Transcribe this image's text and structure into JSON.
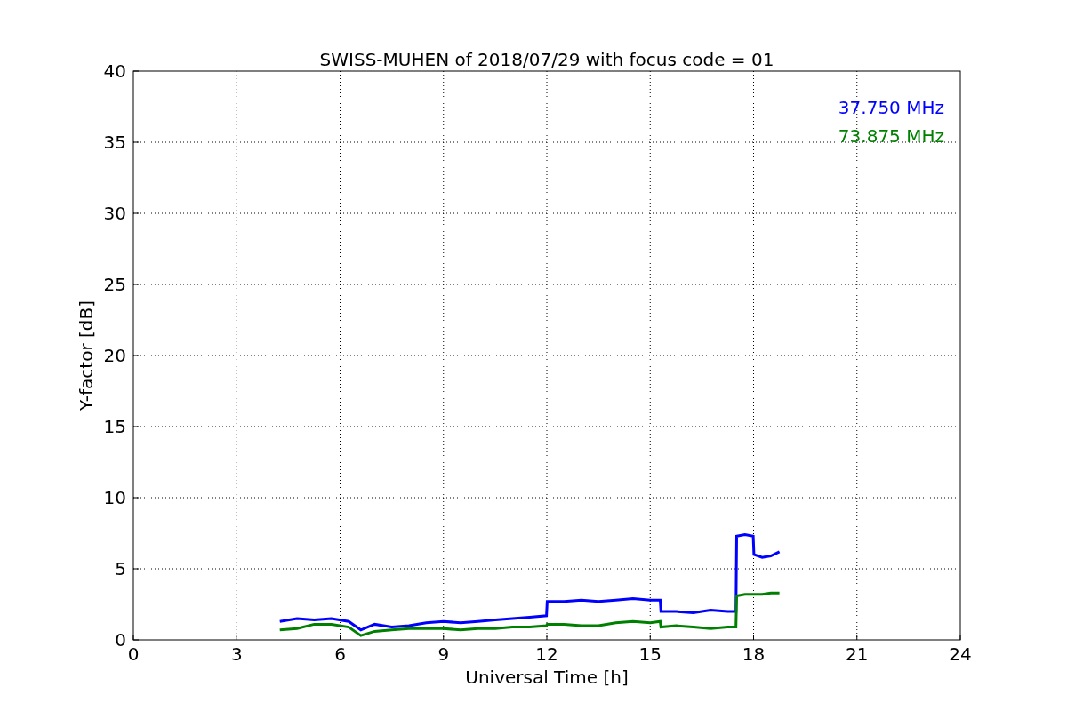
{
  "chart_data": {
    "type": "line",
    "title": "SWISS-MUHEN of 2018/07/29 with focus code = 01",
    "xlabel": "Universal Time [h]",
    "ylabel": "Y-factor [dB]",
    "x": [
      4.25,
      4.75,
      5.25,
      5.75,
      6.25,
      6.6,
      7,
      7.5,
      8,
      8.5,
      9,
      9.5,
      10,
      10.5,
      11,
      11.5,
      11.99,
      12.01,
      12.5,
      13,
      13.5,
      14,
      14.5,
      15,
      15.29,
      15.31,
      15.75,
      16.25,
      16.75,
      17.25,
      17.49,
      17.51,
      17.75,
      17.99,
      18.01,
      18.25,
      18.5,
      18.75
    ],
    "series": [
      {
        "name": "37.750 MHz",
        "color": "#0000ff",
        "values": [
          1.3,
          1.5,
          1.4,
          1.5,
          1.3,
          0.7,
          1.1,
          0.9,
          1.0,
          1.2,
          1.3,
          1.2,
          1.3,
          1.4,
          1.5,
          1.6,
          1.7,
          2.7,
          2.7,
          2.8,
          2.7,
          2.8,
          2.9,
          2.8,
          2.8,
          2.0,
          2.0,
          1.9,
          2.1,
          2.0,
          2.0,
          7.3,
          7.4,
          7.3,
          6.0,
          5.8,
          5.9,
          6.2
        ]
      },
      {
        "name": "73.875 MHz",
        "color": "#008000",
        "values": [
          0.7,
          0.8,
          1.1,
          1.1,
          0.9,
          0.3,
          0.6,
          0.7,
          0.8,
          0.8,
          0.8,
          0.7,
          0.8,
          0.8,
          0.9,
          0.9,
          1.0,
          1.1,
          1.1,
          1.0,
          1.0,
          1.2,
          1.3,
          1.2,
          1.3,
          0.9,
          1.0,
          0.9,
          0.8,
          0.9,
          0.9,
          3.1,
          3.2,
          3.2,
          3.2,
          3.2,
          3.3,
          3.3
        ]
      }
    ],
    "xlim": [
      0,
      24
    ],
    "ylim": [
      0,
      40
    ],
    "xticks": [
      0,
      3,
      6,
      9,
      12,
      15,
      18,
      21,
      24
    ],
    "yticks": [
      0,
      5,
      10,
      15,
      20,
      25,
      30,
      35,
      40
    ],
    "grid": true
  }
}
